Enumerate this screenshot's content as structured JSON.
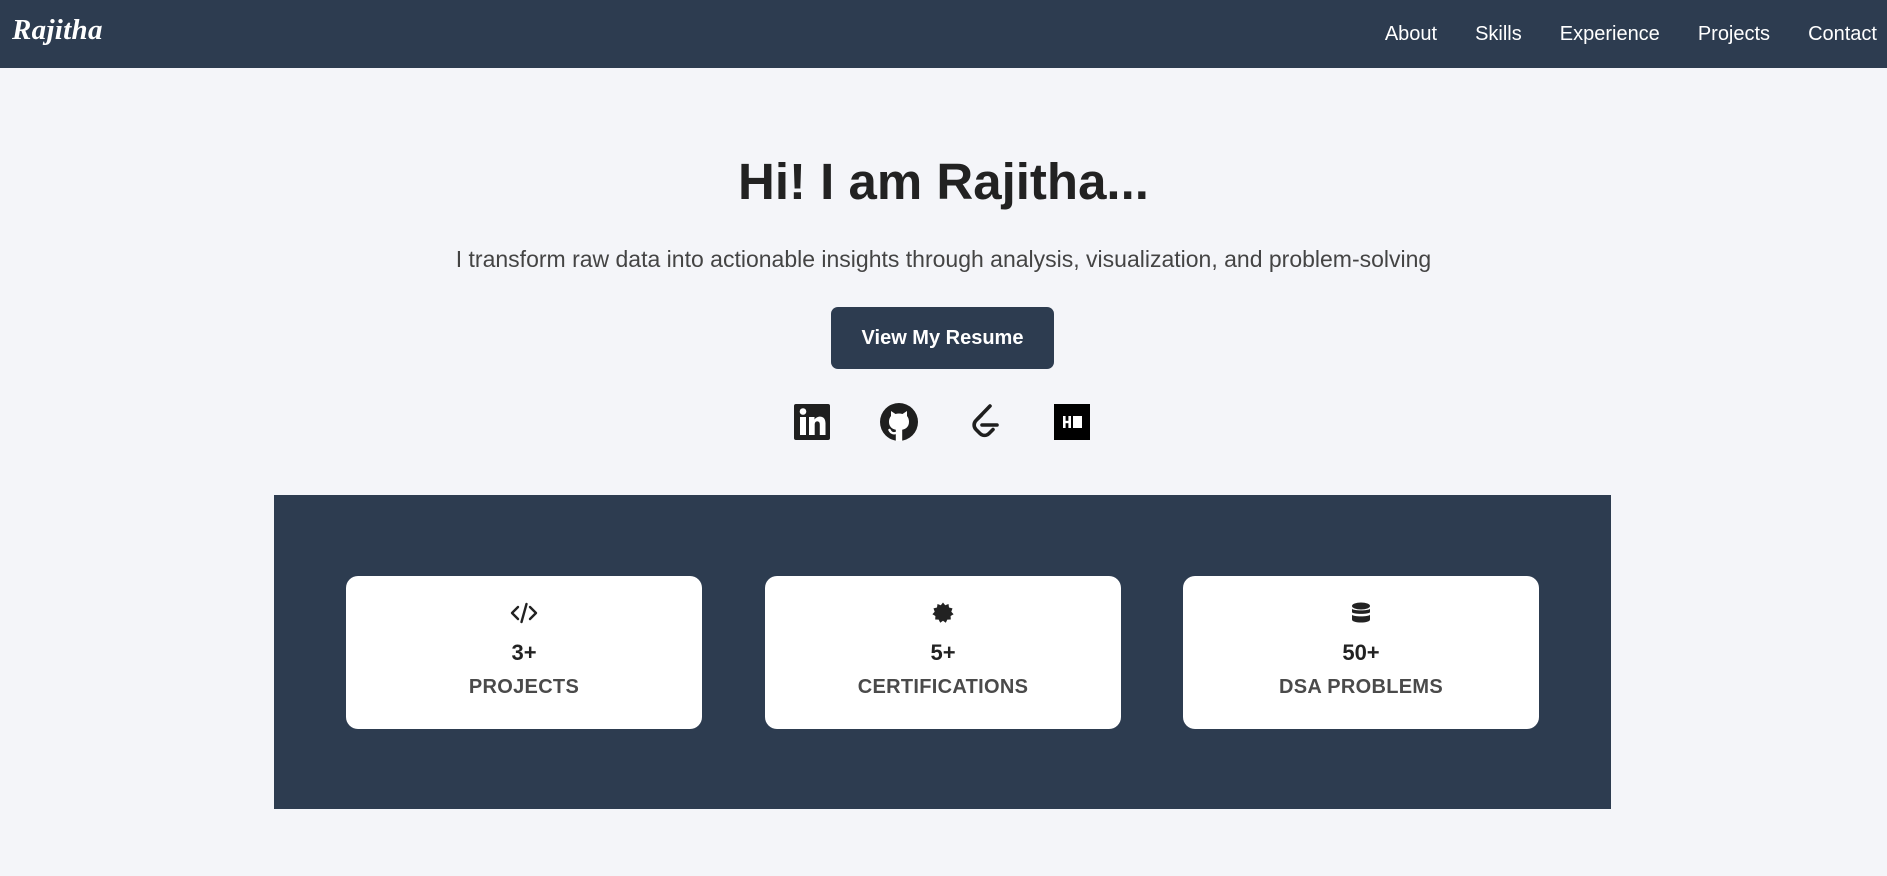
{
  "navbar": {
    "brand": "Rajitha",
    "links": [
      "About",
      "Skills",
      "Experience",
      "Projects",
      "Contact"
    ],
    "background": "#2d3c50"
  },
  "hero": {
    "title": "Hi! I am Rajitha...",
    "subtitle": "I transform raw data into actionable insights through analysis, visualization, and problem-solving",
    "button_label": "View My Resume",
    "socials": [
      "linkedin-icon",
      "github-icon",
      "leetcode-icon",
      "hackerrank-icon"
    ]
  },
  "stats": [
    {
      "icon": "code-icon",
      "value": "3+",
      "label": "PROJECTS"
    },
    {
      "icon": "certificate-icon",
      "value": "5+",
      "label": "CERTIFICATIONS"
    },
    {
      "icon": "database-icon",
      "value": "50+",
      "label": "DSA PROBLEMS"
    }
  ]
}
